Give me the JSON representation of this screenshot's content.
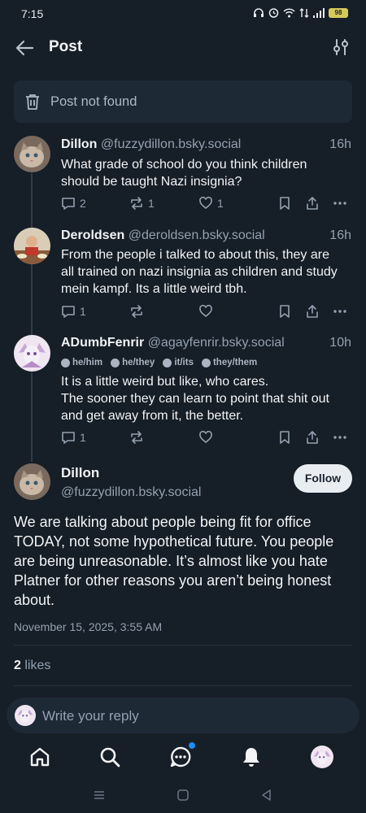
{
  "status_bar": {
    "time": "7:15",
    "battery": "98"
  },
  "header": {
    "title": "Post"
  },
  "not_found": {
    "label": "Post not found"
  },
  "replies": [
    {
      "name": "Dillon",
      "handle": "@fuzzydillon.bsky.social",
      "age": "16h",
      "text": "What grade of school do you think children should be taught Nazi insignia?",
      "reply_count": "2",
      "repost_count": "1",
      "like_count": "1"
    },
    {
      "name": "Deroldsen",
      "handle": "@deroldsen.bsky.social",
      "age": "16h",
      "text": "From the people i talked to about this, they are all trained on nazi insignia as children and study mein kampf. Its a little weird tbh.",
      "reply_count": "1",
      "repost_count": "",
      "like_count": ""
    },
    {
      "name": "ADumbFenrir",
      "handle": "@agayfenrir.bsky.social",
      "age": "10h",
      "pronouns": [
        "he/him",
        "he/they",
        "it/its",
        "they/them"
      ],
      "text_line1": "It is a little weird but like, who cares.",
      "text_line2": "The sooner they can learn to point that shit out and get away from it, the better.",
      "reply_count": "1",
      "repost_count": "",
      "like_count": ""
    }
  ],
  "main_post": {
    "name": "Dillon",
    "handle": "@fuzzydillon.bsky.social",
    "follow_label": "Follow",
    "text": "We are talking about people being fit for office TODAY, not some hypothetical future. You people are being unreasonable. It’s almost like you hate Platner for other reasons you aren’t being honest about.",
    "date": "November 15, 2025, 3:55 AM",
    "likes_count": "2",
    "likes_label": "likes"
  },
  "reply_input": {
    "placeholder": "Write your reply"
  },
  "colors": {
    "background": "#161e27",
    "accent_badge": "#1d8cf8",
    "muted_text": "#93a1b0"
  }
}
